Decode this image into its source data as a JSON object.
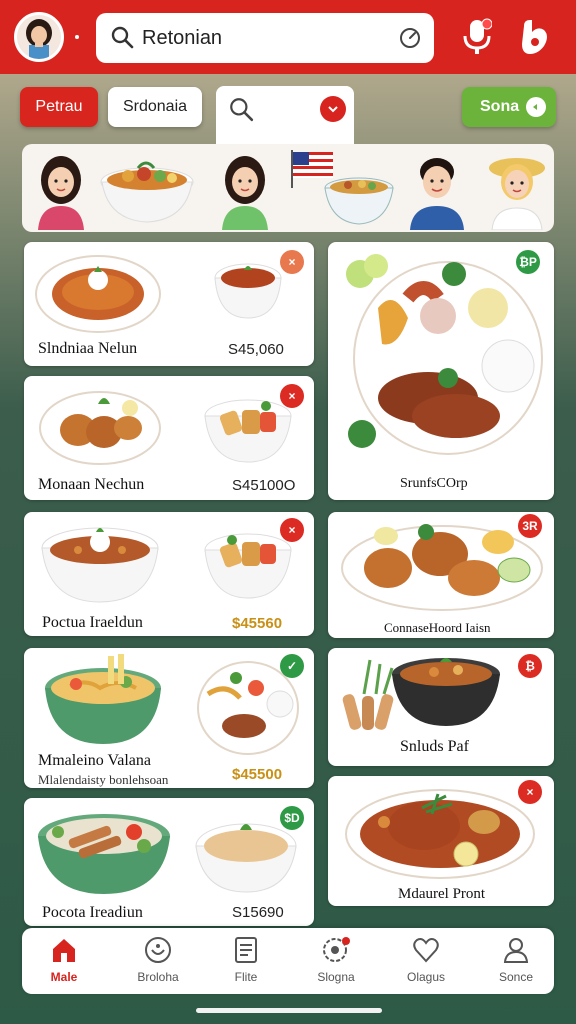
{
  "header": {
    "search_value": "Retonian"
  },
  "filters": {
    "chip1": "Petrau",
    "chip2": "Srdonaia",
    "chip3": "Sona"
  },
  "dishes": [
    {
      "name": "Slndniaa Nelun",
      "price": "S45,060"
    },
    {
      "name": "Monaan Nechun",
      "price": "S45100O"
    },
    {
      "name": "Poctua Iraeldun",
      "price": "$45560"
    },
    {
      "name": "Mmaleino Valana",
      "sub": "Mlalendaisty bonlehsoan",
      "price": "$45500"
    },
    {
      "name": "Pocota Ireadiun",
      "price": "S15690"
    },
    {
      "name": "SrunfsCOrp"
    },
    {
      "name": "ConnaseHoord Iaisn"
    },
    {
      "name": "Snluds Paf"
    },
    {
      "name": "Mdaurel Pront"
    }
  ],
  "badges": {
    "b1": "×",
    "b2": "×",
    "b3": "×",
    "b4": "✓",
    "b5": "$D",
    "b6": "₿P",
    "b7": "3R",
    "b8": "₿",
    "b9": "×"
  },
  "nav": {
    "items": [
      {
        "label": "Male"
      },
      {
        "label": "Broloha"
      },
      {
        "label": "Flite"
      },
      {
        "label": "Slogna"
      },
      {
        "label": "Olagus"
      },
      {
        "label": "Sonce"
      }
    ]
  },
  "colors": {
    "brand_red": "#d8241f",
    "accent_green": "#6bb33b",
    "price_gold": "#c89016"
  },
  "icons": [
    "search-icon",
    "refresh-icon",
    "mic-icon",
    "favorite-icon",
    "chevron-down-icon",
    "home-icon",
    "bowl-icon",
    "list-icon",
    "chat-icon",
    "heart-icon",
    "user-icon"
  ]
}
